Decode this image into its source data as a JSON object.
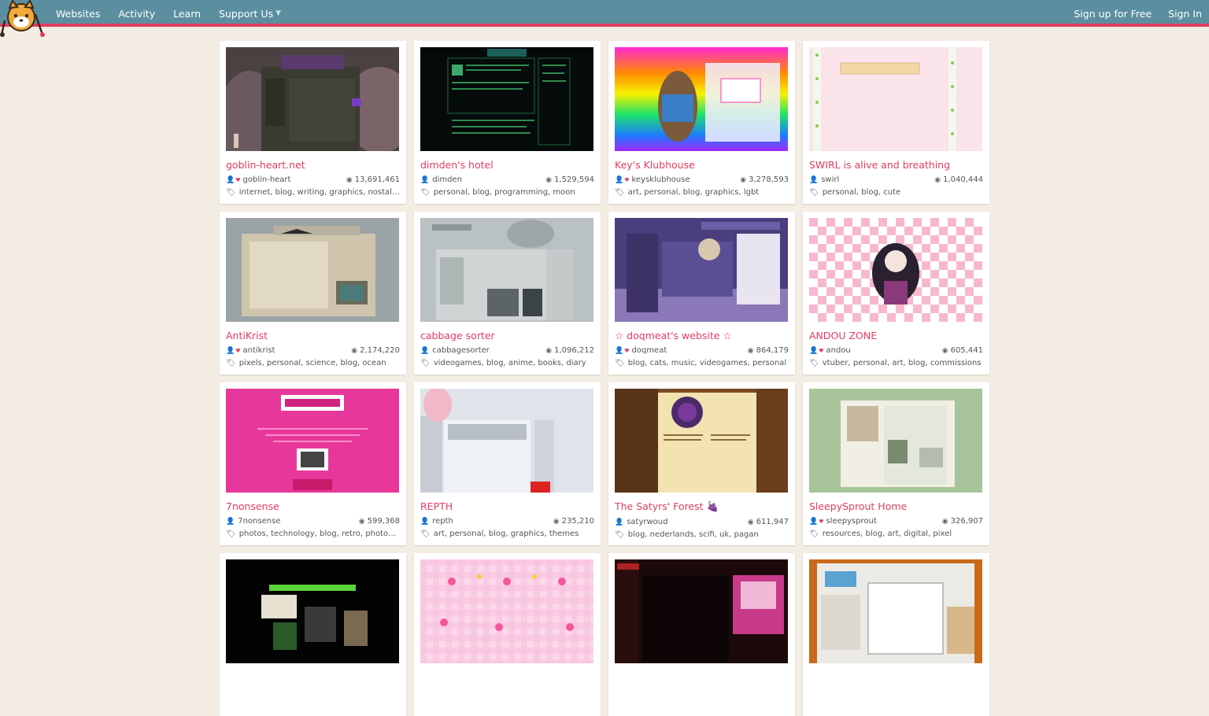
{
  "nav": {
    "items": [
      "Websites",
      "Activity",
      "Learn",
      "Support Us"
    ],
    "signup": "Sign up for Free",
    "signin": "Sign In"
  },
  "colors": {
    "topbar": "#5b8fa0",
    "accent": "#e23d5e",
    "background": "#f4ede4"
  },
  "sites": [
    {
      "title": "goblin-heart.net",
      "owner": "goblin-heart",
      "supporter": true,
      "views": "13,691,461",
      "tags": "internet, blog, writing, graphics, nostalgia"
    },
    {
      "title": "dimden's hotel",
      "owner": "dimden",
      "supporter": false,
      "views": "1,529,594",
      "tags": "personal, blog, programming, moon"
    },
    {
      "title": "Key's Klubhouse",
      "owner": "keysklubhouse",
      "supporter": true,
      "views": "3,278,593",
      "tags": "art, personal, blog, graphics, lgbt"
    },
    {
      "title": "SWIRL is alive and breathing",
      "owner": "swirl",
      "supporter": false,
      "views": "1,040,444",
      "tags": "personal, blog, cute"
    },
    {
      "title": "AntiKrist",
      "owner": "antikrist",
      "supporter": true,
      "views": "2,174,220",
      "tags": "pixels, personal, science, blog, ocean"
    },
    {
      "title": "cabbage sorter",
      "owner": "cabbagesorter",
      "supporter": false,
      "views": "1,096,212",
      "tags": "videogames, blog, anime, books, diary"
    },
    {
      "title": "☆ doqmeat's website ☆",
      "owner": "doqmeat",
      "supporter": true,
      "views": "864,179",
      "tags": "blog, cats, music, videogames, personal"
    },
    {
      "title": "ANDOU ZONE",
      "owner": "andou",
      "supporter": true,
      "views": "605,441",
      "tags": "vtuber, personal, art, blog, commissions"
    },
    {
      "title": "7nonsense",
      "owner": "7nonsense",
      "supporter": false,
      "views": "599,368",
      "tags": "photos, technology, blog, retro, photogr…"
    },
    {
      "title": "REPTH",
      "owner": "repth",
      "supporter": false,
      "views": "235,210",
      "tags": "art, personal, blog, graphics, themes"
    },
    {
      "title": "The Satyrs' Forest 🍇",
      "owner": "satyrwoud",
      "supporter": false,
      "views": "611,947",
      "tags": "blog, nederlands, scifi, uk, pagan"
    },
    {
      "title": "SleepySprout Home",
      "owner": "sleepysprout",
      "supporter": true,
      "views": "326,907",
      "tags": "resources, blog, art, digital, pixel"
    },
    {
      "title": "",
      "owner": "",
      "supporter": false,
      "views": "",
      "tags": ""
    },
    {
      "title": "",
      "owner": "",
      "supporter": false,
      "views": "",
      "tags": ""
    },
    {
      "title": "",
      "owner": "",
      "supporter": false,
      "views": "",
      "tags": ""
    },
    {
      "title": "",
      "owner": "",
      "supporter": false,
      "views": "",
      "tags": ""
    }
  ]
}
